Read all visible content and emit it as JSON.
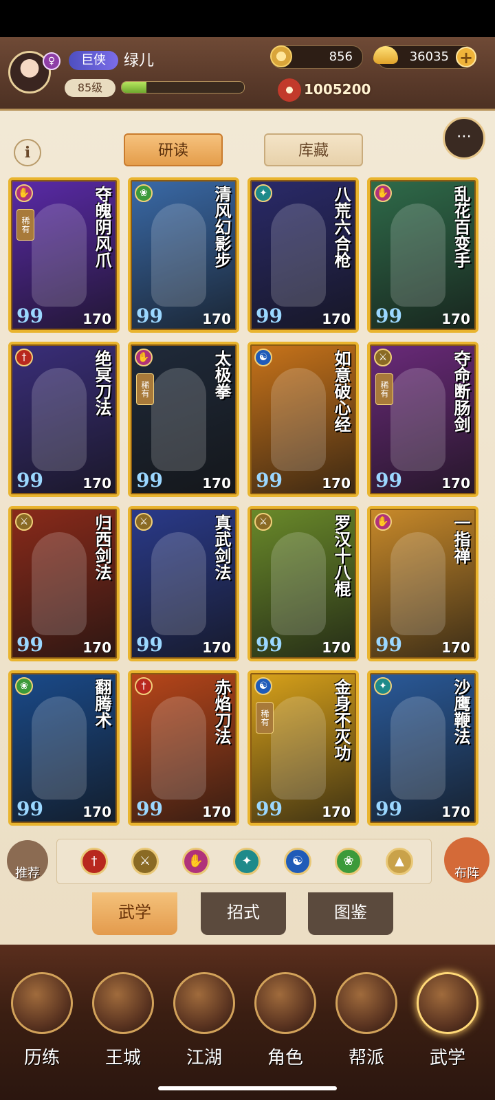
{
  "header": {
    "title_badge": "巨侠",
    "player_name": "绿儿",
    "gender_symbol": "♀",
    "level": "85级",
    "exp_progress": 0.2,
    "coins": "856",
    "ingots": "36035",
    "power": "1005200",
    "plus_label": "+"
  },
  "controls": {
    "info_label": "i",
    "tab_study": "研读",
    "tab_store": "库藏",
    "chat_label": "⋯"
  },
  "cards": [
    {
      "name": "夺魄阴风爪",
      "level": "170",
      "school": "palm",
      "color": "#5a2aa8",
      "rare": "稀有"
    },
    {
      "name": "清风幻影步",
      "level": "170",
      "school": "wind",
      "color": "#3a6aa8",
      "rare": ""
    },
    {
      "name": "八荒六合枪",
      "level": "170",
      "school": "fan",
      "color": "#2a2a6a",
      "rare": ""
    },
    {
      "name": "乱花百变手",
      "level": "170",
      "school": "palm",
      "color": "#2f6b4a",
      "rare": ""
    },
    {
      "name": "绝冥刀法",
      "level": "170",
      "school": "blade",
      "color": "#3a2e7a",
      "rare": ""
    },
    {
      "name": "太极拳",
      "level": "170",
      "school": "palm",
      "color": "#1f2a3a",
      "rare": "稀有"
    },
    {
      "name": "如意破心经",
      "level": "170",
      "school": "taiji",
      "color": "#c9741a",
      "rare": ""
    },
    {
      "name": "夺命断肠剑",
      "level": "170",
      "school": "sword",
      "color": "#6a2a7a",
      "rare": "稀有"
    },
    {
      "name": "归西剑法",
      "level": "170",
      "school": "sword",
      "color": "#8a2a1a",
      "rare": ""
    },
    {
      "name": "真武剑法",
      "level": "170",
      "school": "sword",
      "color": "#2a3a8a",
      "rare": ""
    },
    {
      "name": "罗汉十八棍",
      "level": "170",
      "school": "sword",
      "color": "#6a8a2a",
      "rare": ""
    },
    {
      "name": "一指禅",
      "level": "170",
      "school": "palm",
      "color": "#c98a2a",
      "rare": ""
    },
    {
      "name": "翻腾术",
      "level": "170",
      "school": "wind",
      "color": "#1a4a8a",
      "rare": ""
    },
    {
      "name": "赤焰刀法",
      "level": "170",
      "school": "blade",
      "color": "#b8461a",
      "rare": ""
    },
    {
      "name": "金身不灭功",
      "level": "170",
      "school": "taiji",
      "color": "#d9a21a",
      "rare": "稀有"
    },
    {
      "name": "沙鹰鞭法",
      "level": "170",
      "school": "fan",
      "color": "#2a5a9a",
      "rare": ""
    }
  ],
  "card_quote": "99",
  "filters": {
    "recommend_label": "推荐",
    "formation_label": "布阵",
    "icons": [
      "blade-icon",
      "sword-icon",
      "palm-icon",
      "fan-icon",
      "taiji-icon",
      "wind-icon",
      "up-arrow-icon"
    ]
  },
  "subtabs": [
    "武学",
    "招式",
    "图鉴"
  ],
  "nav": [
    "历练",
    "王城",
    "江湖",
    "角色",
    "帮派",
    "武学"
  ],
  "colors": {
    "card_border": "#e9b42e",
    "accent_orange": "#e49d4a",
    "header_brown": "#5a3a2a"
  }
}
